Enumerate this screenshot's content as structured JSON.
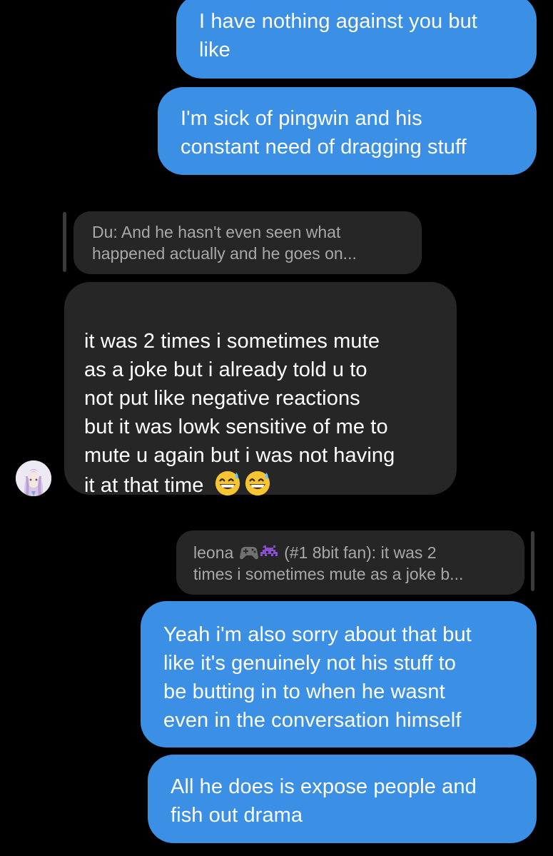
{
  "messages": {
    "m1": "I have nothing against you but\nlike",
    "m2": "I'm sick of pingwin and his\nconstant need of dragging stuff",
    "reply1": "Du: And he hasn't even seen what\nhappened actually and he goes on...",
    "m3": "it was 2 times i sometimes mute\nas a joke but i already told u to\nnot put like negative reactions\nbut it was lowk sensitive of me to\nmute u again but i was not having\nit at that time",
    "reply2_name": "leona",
    "reply2_rest": "(#1 8bit fan): it was 2",
    "reply2_line2": "times i sometimes mute as a joke b...",
    "m4": "Yeah i'm also sorry about that but\nlike it's genuinely not his stuff to\nbe butting in to when he wasnt\neven in the conversation himself",
    "m5": "All he does is expose people and\nfish out drama"
  },
  "icons": {
    "emoji_1": "grinning-sweat-emoji",
    "emoji_2": "grinning-sweat-emoji",
    "reply2_emoji_1": "game-controller-emoji",
    "reply2_emoji_2": "space-invader-emoji",
    "avatar": "anime-avatar"
  },
  "colors": {
    "background": "#000000",
    "sent_bubble": "#3b8fe5",
    "received_bubble": "#262626",
    "reply_text": "#a8a8a8"
  }
}
